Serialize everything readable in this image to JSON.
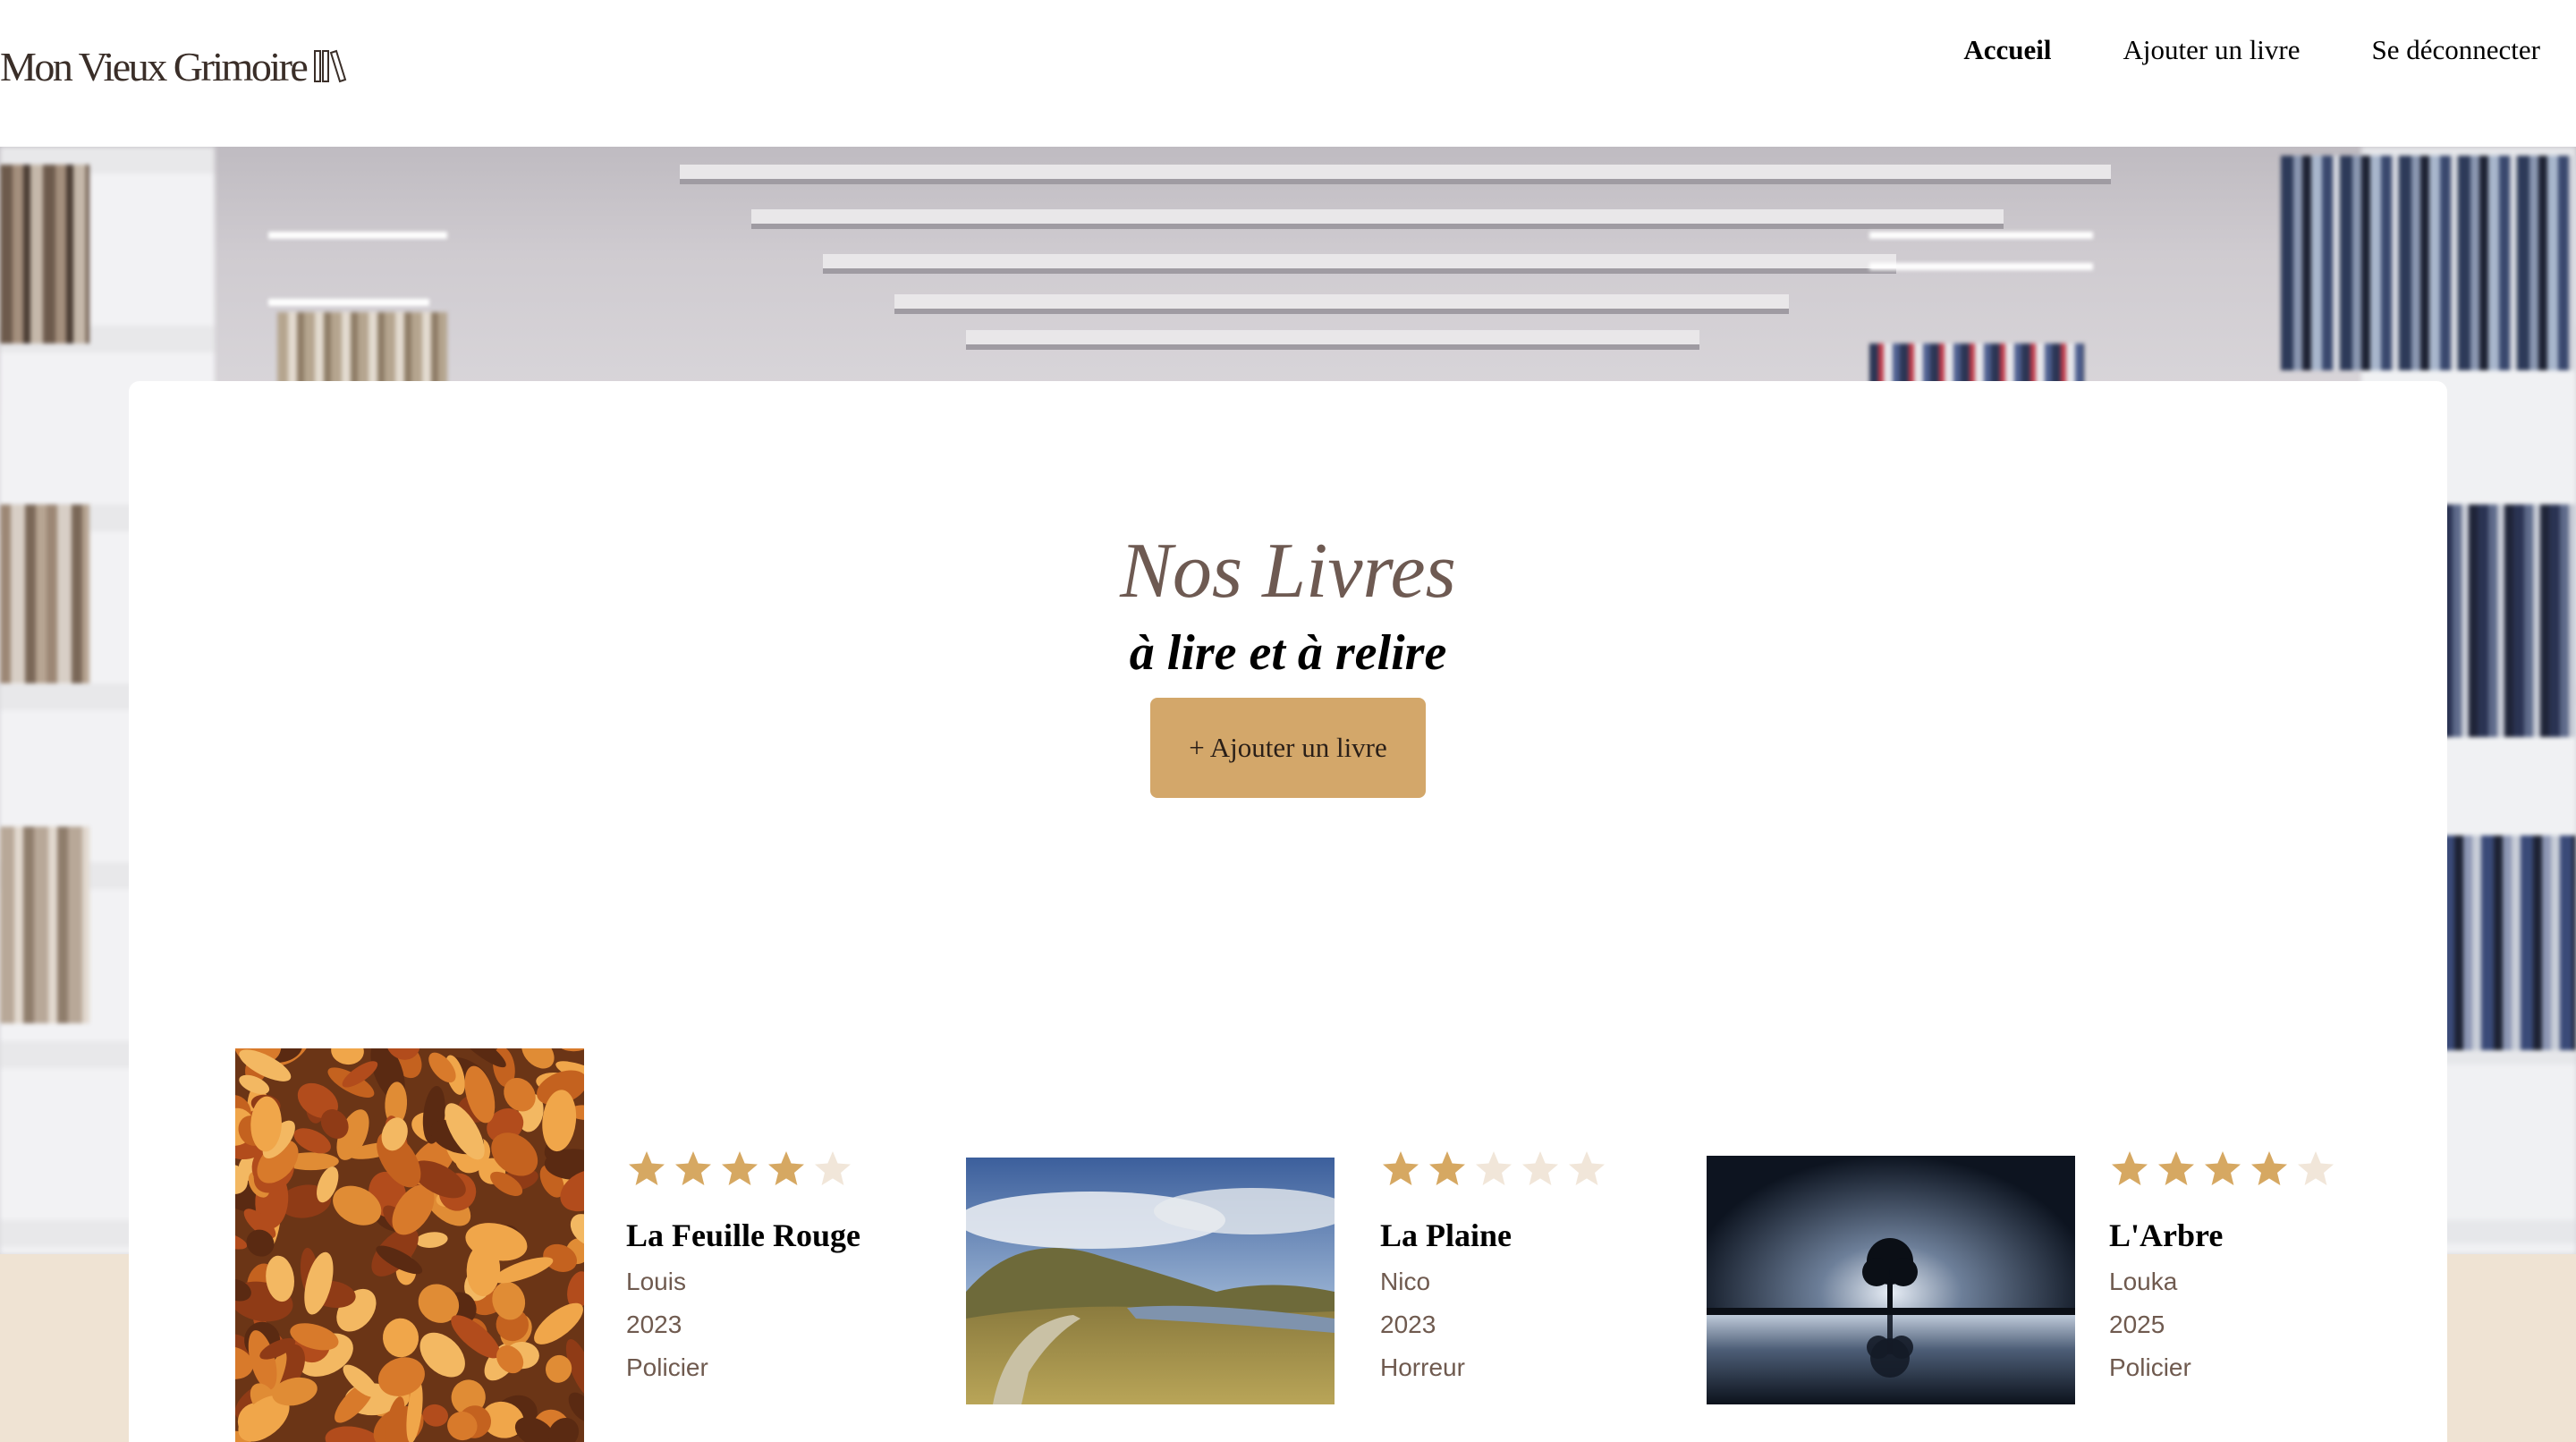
{
  "header": {
    "logo_text": "Mon Vieux Grimoire",
    "nav": [
      {
        "label": "Accueil",
        "active": true
      },
      {
        "label": "Ajouter un livre",
        "active": false
      },
      {
        "label": "Se déconnecter",
        "active": false
      }
    ]
  },
  "hero": {
    "title": "Nos Livres",
    "subtitle": "à lire et à relire",
    "add_button_label": "+ Ajouter un livre"
  },
  "colors": {
    "accent": "#d3a76a",
    "star_filled": "#d6a862",
    "star_empty": "#f1e6d9",
    "title_brown": "#6e5a52",
    "band_beige": "#efe3d3"
  },
  "books": [
    {
      "title": "La Feuille Rouge",
      "author": "Louis",
      "year": "2023",
      "genre": "Policier",
      "rating": 4,
      "cover": "autumn-leaves"
    },
    {
      "title": "La Plaine",
      "author": "Nico",
      "year": "2023",
      "genre": "Horreur",
      "rating": 2,
      "cover": "mountain-plain"
    },
    {
      "title": "L'Arbre",
      "author": "Louka",
      "year": "2025",
      "genre": "Policier",
      "rating": 4,
      "cover": "tree-reflection"
    }
  ]
}
